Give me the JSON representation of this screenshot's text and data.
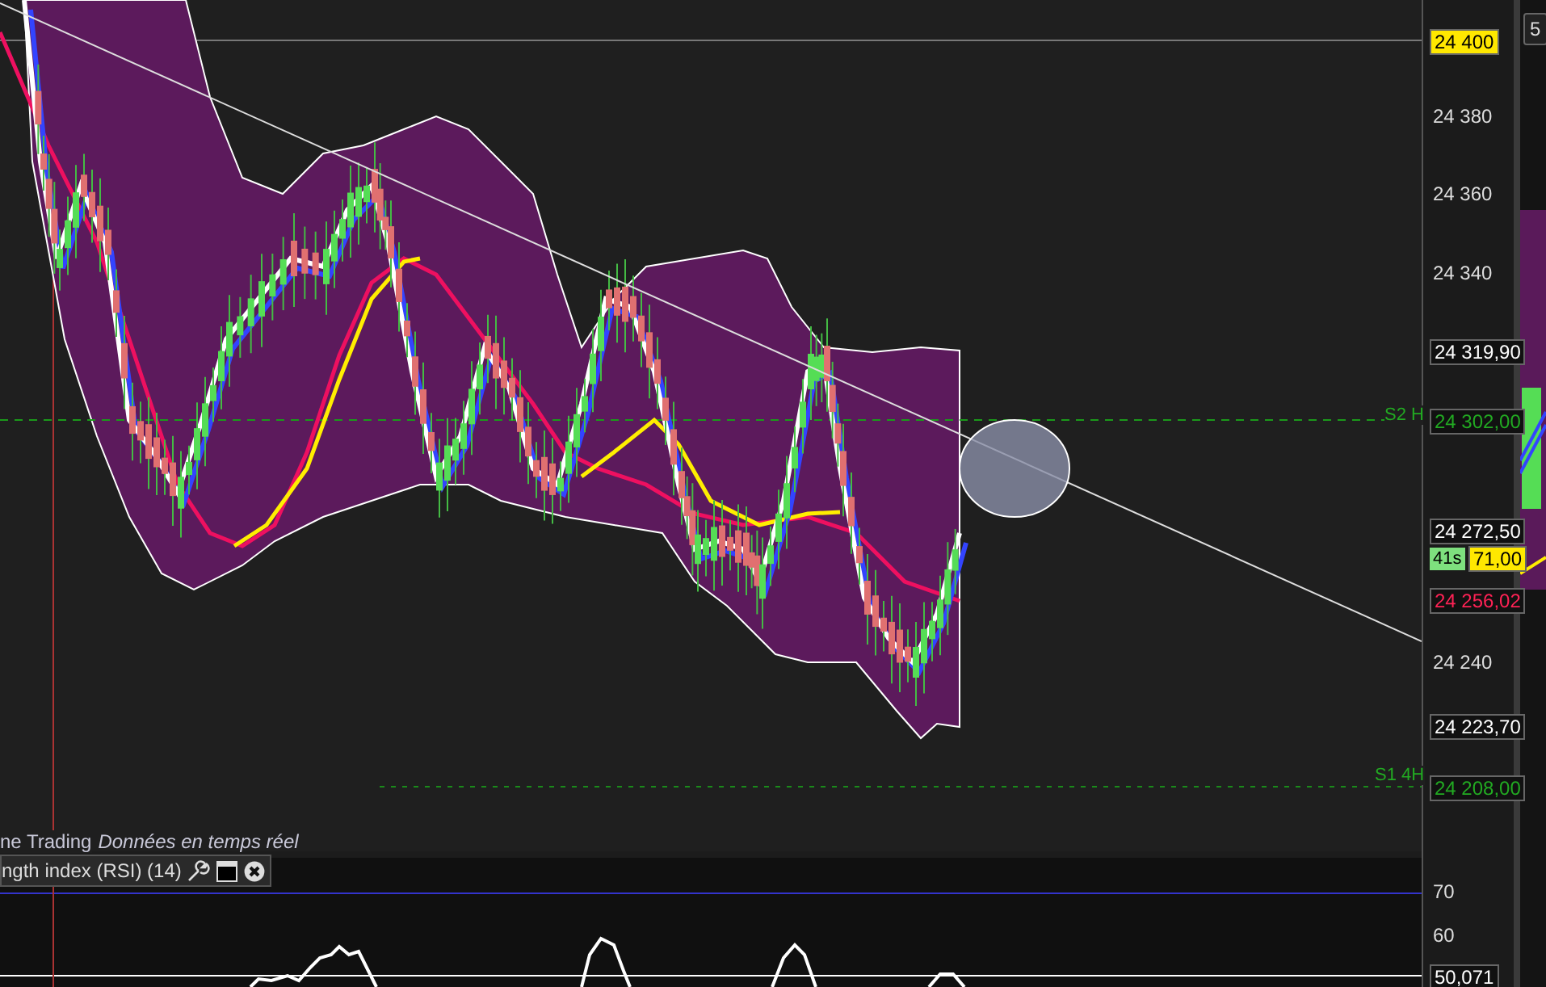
{
  "price_axis": {
    "labels": [
      {
        "text": "24 400",
        "kind": "last"
      },
      {
        "text": "24 380",
        "kind": "tick"
      },
      {
        "text": "24 360",
        "kind": "tick"
      },
      {
        "text": "24 340",
        "kind": "tick"
      },
      {
        "text": "24 319,90",
        "kind": "box"
      },
      {
        "text": "24 302,00",
        "kind": "level"
      },
      {
        "text": "24 272,50",
        "kind": "box"
      },
      {
        "text": "71,00",
        "kind": "last"
      },
      {
        "text": "24 256,02",
        "kind": "ma"
      },
      {
        "text": "24 240",
        "kind": "tick"
      },
      {
        "text": "24 223,70",
        "kind": "box"
      },
      {
        "text": "24 208,00",
        "kind": "level"
      }
    ],
    "countdown": "41s"
  },
  "levels": [
    {
      "label": "S2 H"
    },
    {
      "label": "S1 4H"
    }
  ],
  "footer": {
    "source": "ne Trading",
    "status": "Données en temps réel"
  },
  "rsi": {
    "title": "ngth index (RSI) (14)",
    "axis": [
      {
        "text": "70",
        "kind": "tick"
      },
      {
        "text": "60",
        "kind": "tick"
      },
      {
        "text": "50,071",
        "kind": "box"
      }
    ]
  },
  "side_panel": {
    "button": "5"
  }
}
